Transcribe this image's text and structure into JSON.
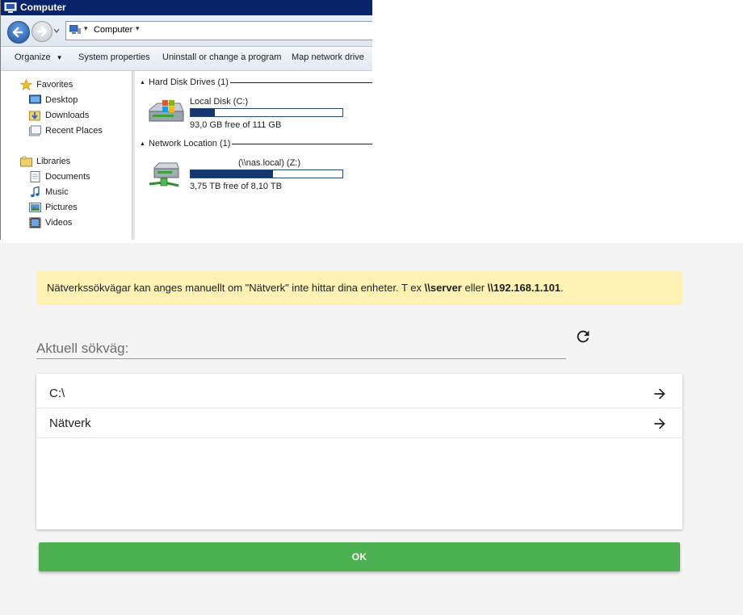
{
  "explorer": {
    "title": "Computer",
    "address": {
      "label": "Computer"
    },
    "toolbar": {
      "organize": "Organize",
      "system_properties": "System properties",
      "uninstall": "Uninstall or change a program",
      "map_drive": "Map network drive"
    },
    "nav_pane": {
      "favorites": "Favorites",
      "desktop": "Desktop",
      "downloads": "Downloads",
      "recent_places": "Recent Places",
      "libraries": "Libraries",
      "documents": "Documents",
      "music": "Music",
      "pictures": "Pictures",
      "videos": "Videos"
    },
    "groups": {
      "hard_disk": "Hard Disk Drives (1)",
      "network": "Network Location (1)"
    },
    "drives": {
      "local": {
        "name": "Local Disk (C:)",
        "free_text": "93,0 GB free of 111 GB",
        "used_fraction": 0.16
      },
      "network": {
        "name": "(\\\\nas.local) (Z:)",
        "free_text": "3,75 TB free of 8,10 TB",
        "used_fraction": 0.54
      }
    },
    "colors": {
      "title_bar": "#0a246a",
      "usage_bar": "#11376e"
    }
  },
  "dialog": {
    "info": {
      "prefix": "Nätverkssökvägar kan anges manuellt om \"Nätverk\" inte hittar dina enheter. T ex ",
      "example1": "\\\\server",
      "middle": " eller ",
      "example2": "\\\\192.168.1.101",
      "suffix": "."
    },
    "path_placeholder": "Aktuell sökväg:",
    "path_value": "",
    "items": [
      {
        "label": "C:\\"
      },
      {
        "label": "Nätverk"
      }
    ],
    "ok_label": "OK",
    "colors": {
      "info_bg": "#fdf2b3",
      "ok_bg": "#4caf50"
    }
  }
}
